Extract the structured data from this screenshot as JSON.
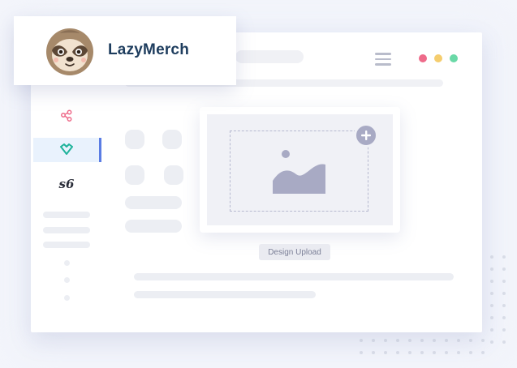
{
  "brand": {
    "name": "LazyMerch",
    "logo_icon": "sloth-logo-icon"
  },
  "window": {
    "traffic_lights": [
      "#ee6b8a",
      "#f5cd6e",
      "#6ad9a7"
    ],
    "menu_icon": "hamburger-menu-icon"
  },
  "sidebar": {
    "items": [
      {
        "icon": "share-nodes-icon",
        "color": "#ee6b8a",
        "active": false
      },
      {
        "icon": "heart-diamond-icon",
        "color": "#1fb39b",
        "active": true
      },
      {
        "label": "s6",
        "active": false
      }
    ]
  },
  "upload": {
    "label": "Design Upload",
    "add_icon": "plus-circle-icon",
    "image_icon": "image-placeholder-icon"
  }
}
